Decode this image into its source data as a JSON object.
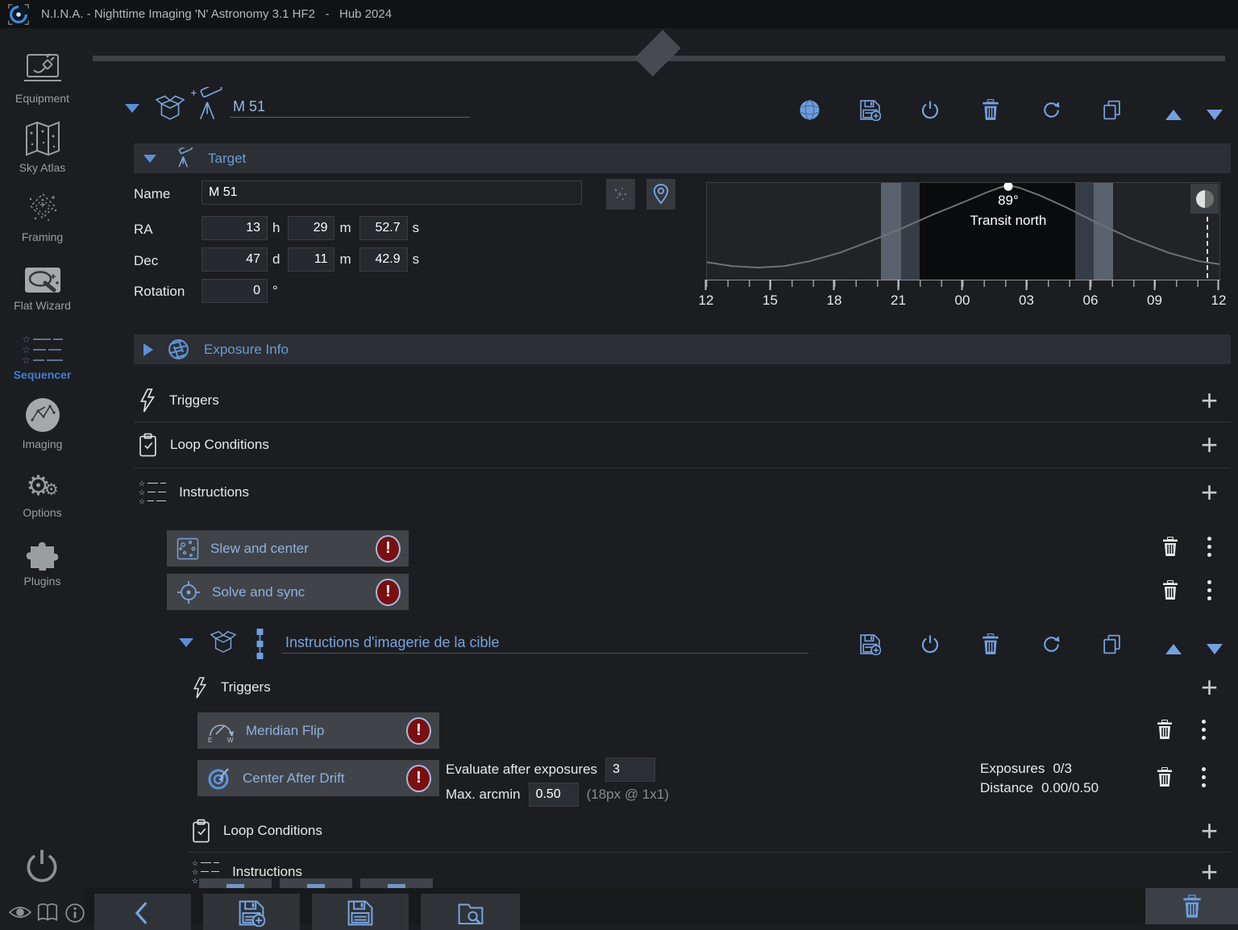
{
  "titlebar": {
    "title": "N.I.N.A. - Nighttime Imaging 'N' Astronomy 3.1 HF2   -   Hub 2024"
  },
  "sidebar": {
    "items": [
      {
        "label": "Equipment"
      },
      {
        "label": "Sky Atlas"
      },
      {
        "label": "Framing"
      },
      {
        "label": "Flat Wizard"
      },
      {
        "label": "Sequencer"
      },
      {
        "label": "Imaging"
      },
      {
        "label": "Options"
      },
      {
        "label": "Plugins"
      }
    ]
  },
  "sequence": {
    "title": "M 51",
    "target": {
      "header": "Target",
      "name_label": "Name",
      "name_value": "M 51",
      "ra_label": "RA",
      "ra_h": "13",
      "ra_h_unit": "h",
      "ra_m": "29",
      "ra_m_unit": "m",
      "ra_s": "52.7",
      "ra_s_unit": "s",
      "dec_label": "Dec",
      "dec_d": "47",
      "dec_d_unit": "d",
      "dec_m": "11",
      "dec_m_unit": "m",
      "dec_s": "42.9",
      "dec_s_unit": "s",
      "rotation_label": "Rotation",
      "rotation_value": "0",
      "rotation_unit": "°"
    },
    "exposure_info_label": "Exposure Info",
    "triggers_label": "Triggers",
    "loop_conditions_label": "Loop Conditions",
    "instructions_label": "Instructions",
    "instructions": [
      {
        "label": "Slew and center"
      },
      {
        "label": "Solve and sync"
      }
    ]
  },
  "altitude_chart": {
    "type": "line",
    "peak_label": "89°",
    "peak_annotation": "Transit north",
    "x_ticks": [
      "12",
      "15",
      "18",
      "21",
      "00",
      "03",
      "06",
      "09",
      "12"
    ],
    "bands": [
      {
        "from": 0.34,
        "to": 0.379,
        "level": "twilight"
      },
      {
        "from": 0.379,
        "to": 0.415,
        "level": "dusk"
      },
      {
        "from": 0.415,
        "to": 0.718,
        "level": "night"
      },
      {
        "from": 0.718,
        "to": 0.755,
        "level": "dusk"
      },
      {
        "from": 0.755,
        "to": 0.792,
        "level": "twilight"
      }
    ],
    "curve_points": [
      [
        0,
        0.82
      ],
      [
        0.05,
        0.86
      ],
      [
        0.1,
        0.875
      ],
      [
        0.15,
        0.86
      ],
      [
        0.2,
        0.81
      ],
      [
        0.26,
        0.72
      ],
      [
        0.32,
        0.6
      ],
      [
        0.38,
        0.47
      ],
      [
        0.44,
        0.33
      ],
      [
        0.5,
        0.2
      ],
      [
        0.545,
        0.1
      ],
      [
        0.57,
        0.05
      ],
      [
        0.588,
        0.025
      ],
      [
        0.61,
        0.05
      ],
      [
        0.65,
        0.13
      ],
      [
        0.7,
        0.25
      ],
      [
        0.76,
        0.41
      ],
      [
        0.83,
        0.58
      ],
      [
        0.9,
        0.72
      ],
      [
        0.96,
        0.81
      ],
      [
        1,
        0.84
      ]
    ],
    "peak_point": [
      0.588,
      0.035
    ],
    "now_fraction": 0.975
  },
  "nested_sequence": {
    "title": "Instructions d'imagerie de la cible",
    "triggers_label": "Triggers",
    "loop_conditions_label": "Loop Conditions",
    "instructions_label": "Instructions",
    "triggers": [
      {
        "label": "Meridian Flip"
      },
      {
        "label": "Center After Drift",
        "evaluate_label": "Evaluate after exposures",
        "evaluate_value": "3",
        "max_arcmin_label": "Max. arcmin",
        "max_arcmin_value": "0.50",
        "scale_hint": "(18px @ 1x1)",
        "exposures_label": "Exposures",
        "exposures_value": "0/3",
        "distance_label": "Distance",
        "distance_value": "0.00/0.50"
      }
    ]
  },
  "colors": {
    "accent": "#74a0e2",
    "header_blue": "#6b9bd8",
    "error_red": "#7a0f12",
    "night": "#0a0b0d"
  }
}
